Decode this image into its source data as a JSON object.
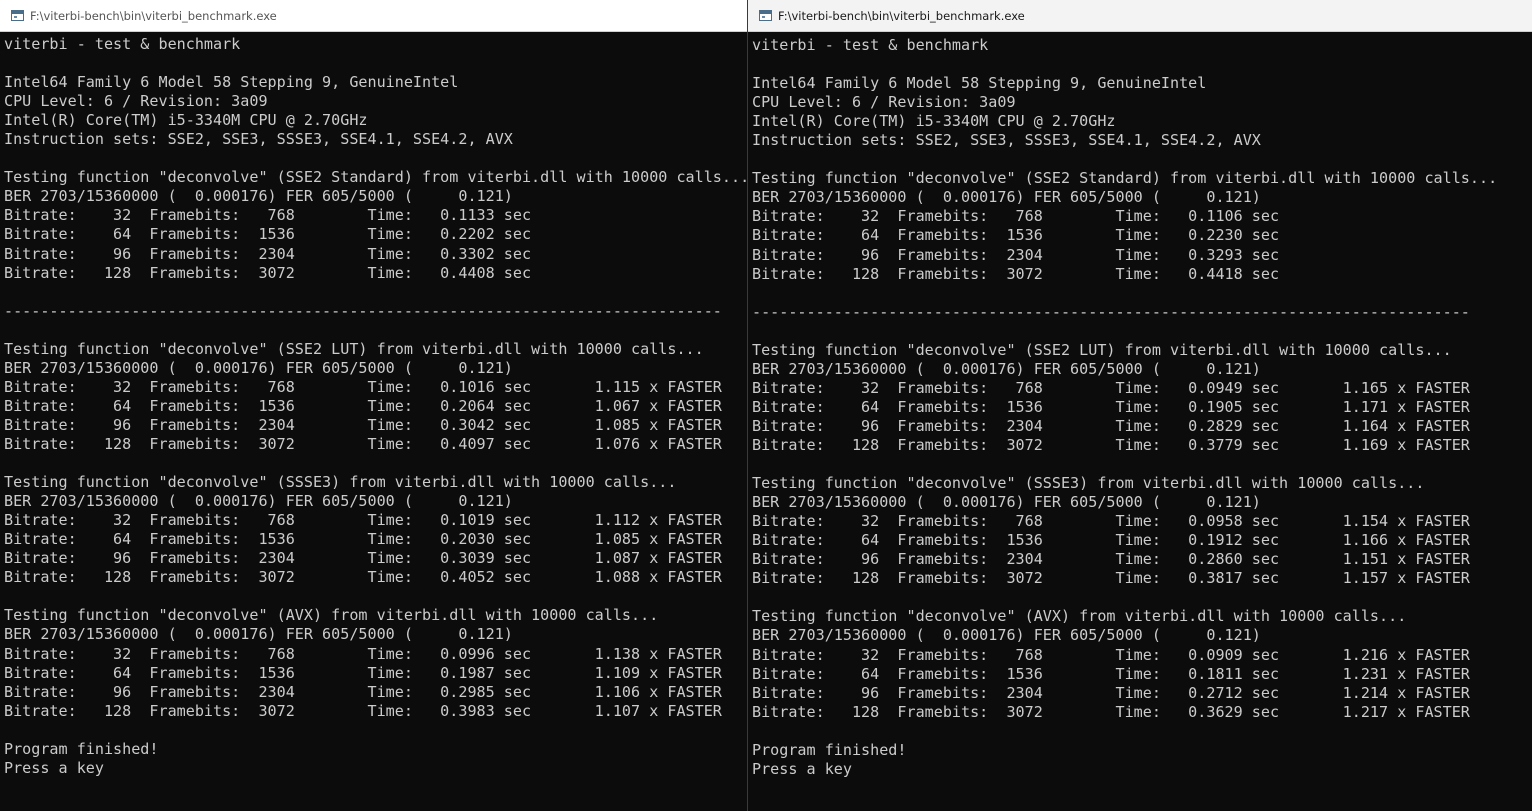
{
  "left_window": {
    "title": "F:\\viterbi-bench\\bin\\viterbi_benchmark.exe",
    "lines": [
      "viterbi - test & benchmark",
      "",
      "Intel64 Family 6 Model 58 Stepping 9, GenuineIntel",
      "CPU Level: 6 / Revision: 3a09",
      "Intel(R) Core(TM) i5-3340M CPU @ 2.70GHz",
      "Instruction sets: SSE2, SSE3, SSSE3, SSE4.1, SSE4.2, AVX",
      "",
      "Testing function \"deconvolve\" (SSE2 Standard) from viterbi.dll with 10000 calls...",
      "BER 2703/15360000 (  0.000176) FER 605/5000 (     0.121)",
      "Bitrate:    32  Framebits:   768        Time:   0.1133 sec",
      "Bitrate:    64  Framebits:  1536        Time:   0.2202 sec",
      "Bitrate:    96  Framebits:  2304        Time:   0.3302 sec",
      "Bitrate:   128  Framebits:  3072        Time:   0.4408 sec",
      "",
      "-------------------------------------------------------------------------------",
      "",
      "Testing function \"deconvolve\" (SSE2 LUT) from viterbi.dll with 10000 calls...",
      "BER 2703/15360000 (  0.000176) FER 605/5000 (     0.121)",
      "Bitrate:    32  Framebits:   768        Time:   0.1016 sec       1.115 x FASTER",
      "Bitrate:    64  Framebits:  1536        Time:   0.2064 sec       1.067 x FASTER",
      "Bitrate:    96  Framebits:  2304        Time:   0.3042 sec       1.085 x FASTER",
      "Bitrate:   128  Framebits:  3072        Time:   0.4097 sec       1.076 x FASTER",
      "",
      "Testing function \"deconvolve\" (SSSE3) from viterbi.dll with 10000 calls...",
      "BER 2703/15360000 (  0.000176) FER 605/5000 (     0.121)",
      "Bitrate:    32  Framebits:   768        Time:   0.1019 sec       1.112 x FASTER",
      "Bitrate:    64  Framebits:  1536        Time:   0.2030 sec       1.085 x FASTER",
      "Bitrate:    96  Framebits:  2304        Time:   0.3039 sec       1.087 x FASTER",
      "Bitrate:   128  Framebits:  3072        Time:   0.4052 sec       1.088 x FASTER",
      "",
      "Testing function \"deconvolve\" (AVX) from viterbi.dll with 10000 calls...",
      "BER 2703/15360000 (  0.000176) FER 605/5000 (     0.121)",
      "Bitrate:    32  Framebits:   768        Time:   0.0996 sec       1.138 x FASTER",
      "Bitrate:    64  Framebits:  1536        Time:   0.1987 sec       1.109 x FASTER",
      "Bitrate:    96  Framebits:  2304        Time:   0.2985 sec       1.106 x FASTER",
      "Bitrate:   128  Framebits:  3072        Time:   0.3983 sec       1.107 x FASTER",
      "",
      "Program finished!",
      "Press a key"
    ]
  },
  "right_window": {
    "title": "F:\\viterbi-bench\\bin\\viterbi_benchmark.exe",
    "lines": [
      "viterbi - test & benchmark",
      "",
      "Intel64 Family 6 Model 58 Stepping 9, GenuineIntel",
      "CPU Level: 6 / Revision: 3a09",
      "Intel(R) Core(TM) i5-3340M CPU @ 2.70GHz",
      "Instruction sets: SSE2, SSE3, SSSE3, SSE4.1, SSE4.2, AVX",
      "",
      "Testing function \"deconvolve\" (SSE2 Standard) from viterbi.dll with 10000 calls...",
      "BER 2703/15360000 (  0.000176) FER 605/5000 (     0.121)",
      "Bitrate:    32  Framebits:   768        Time:   0.1106 sec",
      "Bitrate:    64  Framebits:  1536        Time:   0.2230 sec",
      "Bitrate:    96  Framebits:  2304        Time:   0.3293 sec",
      "Bitrate:   128  Framebits:  3072        Time:   0.4418 sec",
      "",
      "-------------------------------------------------------------------------------",
      "",
      "Testing function \"deconvolve\" (SSE2 LUT) from viterbi.dll with 10000 calls...",
      "BER 2703/15360000 (  0.000176) FER 605/5000 (     0.121)",
      "Bitrate:    32  Framebits:   768        Time:   0.0949 sec       1.165 x FASTER",
      "Bitrate:    64  Framebits:  1536        Time:   0.1905 sec       1.171 x FASTER",
      "Bitrate:    96  Framebits:  2304        Time:   0.2829 sec       1.164 x FASTER",
      "Bitrate:   128  Framebits:  3072        Time:   0.3779 sec       1.169 x FASTER",
      "",
      "Testing function \"deconvolve\" (SSSE3) from viterbi.dll with 10000 calls...",
      "BER 2703/15360000 (  0.000176) FER 605/5000 (     0.121)",
      "Bitrate:    32  Framebits:   768        Time:   0.0958 sec       1.154 x FASTER",
      "Bitrate:    64  Framebits:  1536        Time:   0.1912 sec       1.166 x FASTER",
      "Bitrate:    96  Framebits:  2304        Time:   0.2860 sec       1.151 x FASTER",
      "Bitrate:   128  Framebits:  3072        Time:   0.3817 sec       1.157 x FASTER",
      "",
      "Testing function \"deconvolve\" (AVX) from viterbi.dll with 10000 calls...",
      "BER 2703/15360000 (  0.000176) FER 605/5000 (     0.121)",
      "Bitrate:    32  Framebits:   768        Time:   0.0909 sec       1.216 x FASTER",
      "Bitrate:    64  Framebits:  1536        Time:   0.1811 sec       1.231 x FASTER",
      "Bitrate:    96  Framebits:  2304        Time:   0.2712 sec       1.214 x FASTER",
      "Bitrate:   128  Framebits:  3072        Time:   0.3629 sec       1.217 x FASTER",
      "",
      "Program finished!",
      "Press a key"
    ]
  },
  "colors": {
    "console_background": "#0c0c0c",
    "console_text": "#cccccc",
    "titlebar_inactive": "#ffffff",
    "titlebar_active": "#f3f3f3"
  },
  "icons": {
    "window_icon": "console-app-icon"
  }
}
